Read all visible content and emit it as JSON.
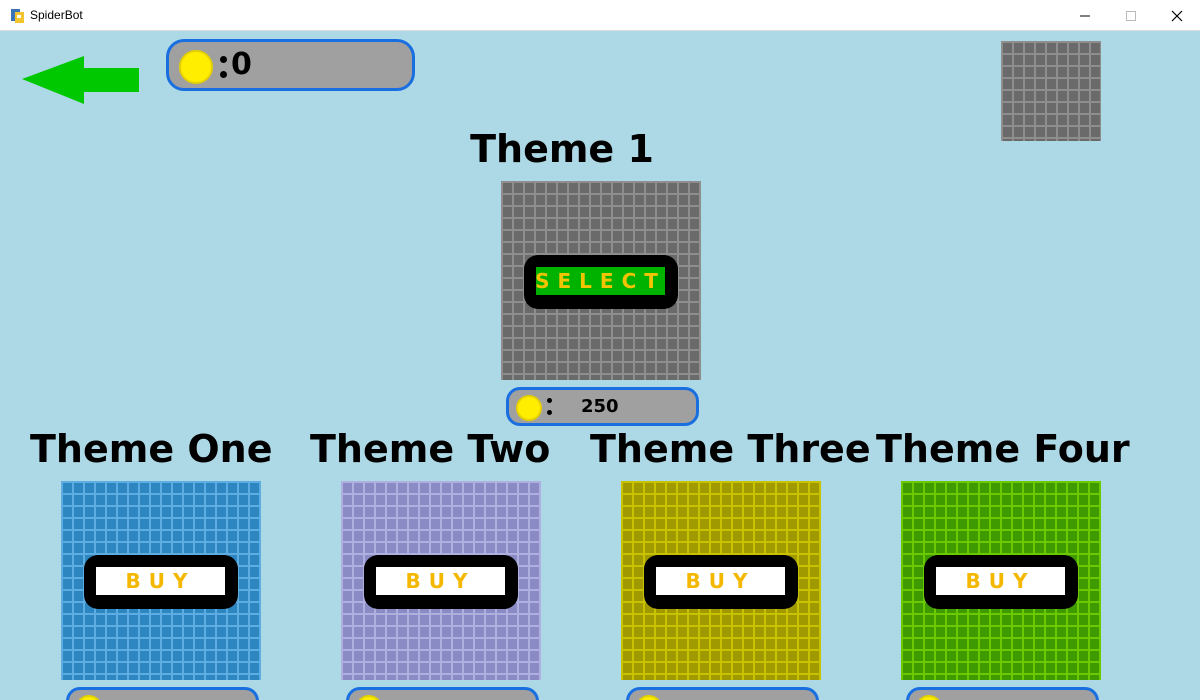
{
  "window": {
    "title": "SpiderBot"
  },
  "hud": {
    "coin_count": "0"
  },
  "selected_theme": {
    "title": "Theme 1",
    "select_label": "SELECT",
    "price": "250",
    "brick_color": "#6a6a6a",
    "mortar_color": "#8e8e8e"
  },
  "themes": [
    {
      "title": "Theme One",
      "buy_label": "BUY",
      "brick_color": "#2e86c1",
      "mortar_color": "#5dade2"
    },
    {
      "title": "Theme Two",
      "buy_label": "BUY",
      "brick_color": "#8a8ac4",
      "mortar_color": "#b0b0e0"
    },
    {
      "title": "Theme Three",
      "buy_label": "BUY",
      "brick_color": "#a09a00",
      "mortar_color": "#c9c200"
    },
    {
      "title": "Theme Four",
      "buy_label": "BUY",
      "brick_color": "#3f9a00",
      "mortar_color": "#6cc900"
    }
  ],
  "colors": {
    "background": "#add8e6",
    "hud_border": "#1a6fe0",
    "coin": "#ffee00",
    "select_fill": "#00b200",
    "button_text": "#f5c400"
  }
}
